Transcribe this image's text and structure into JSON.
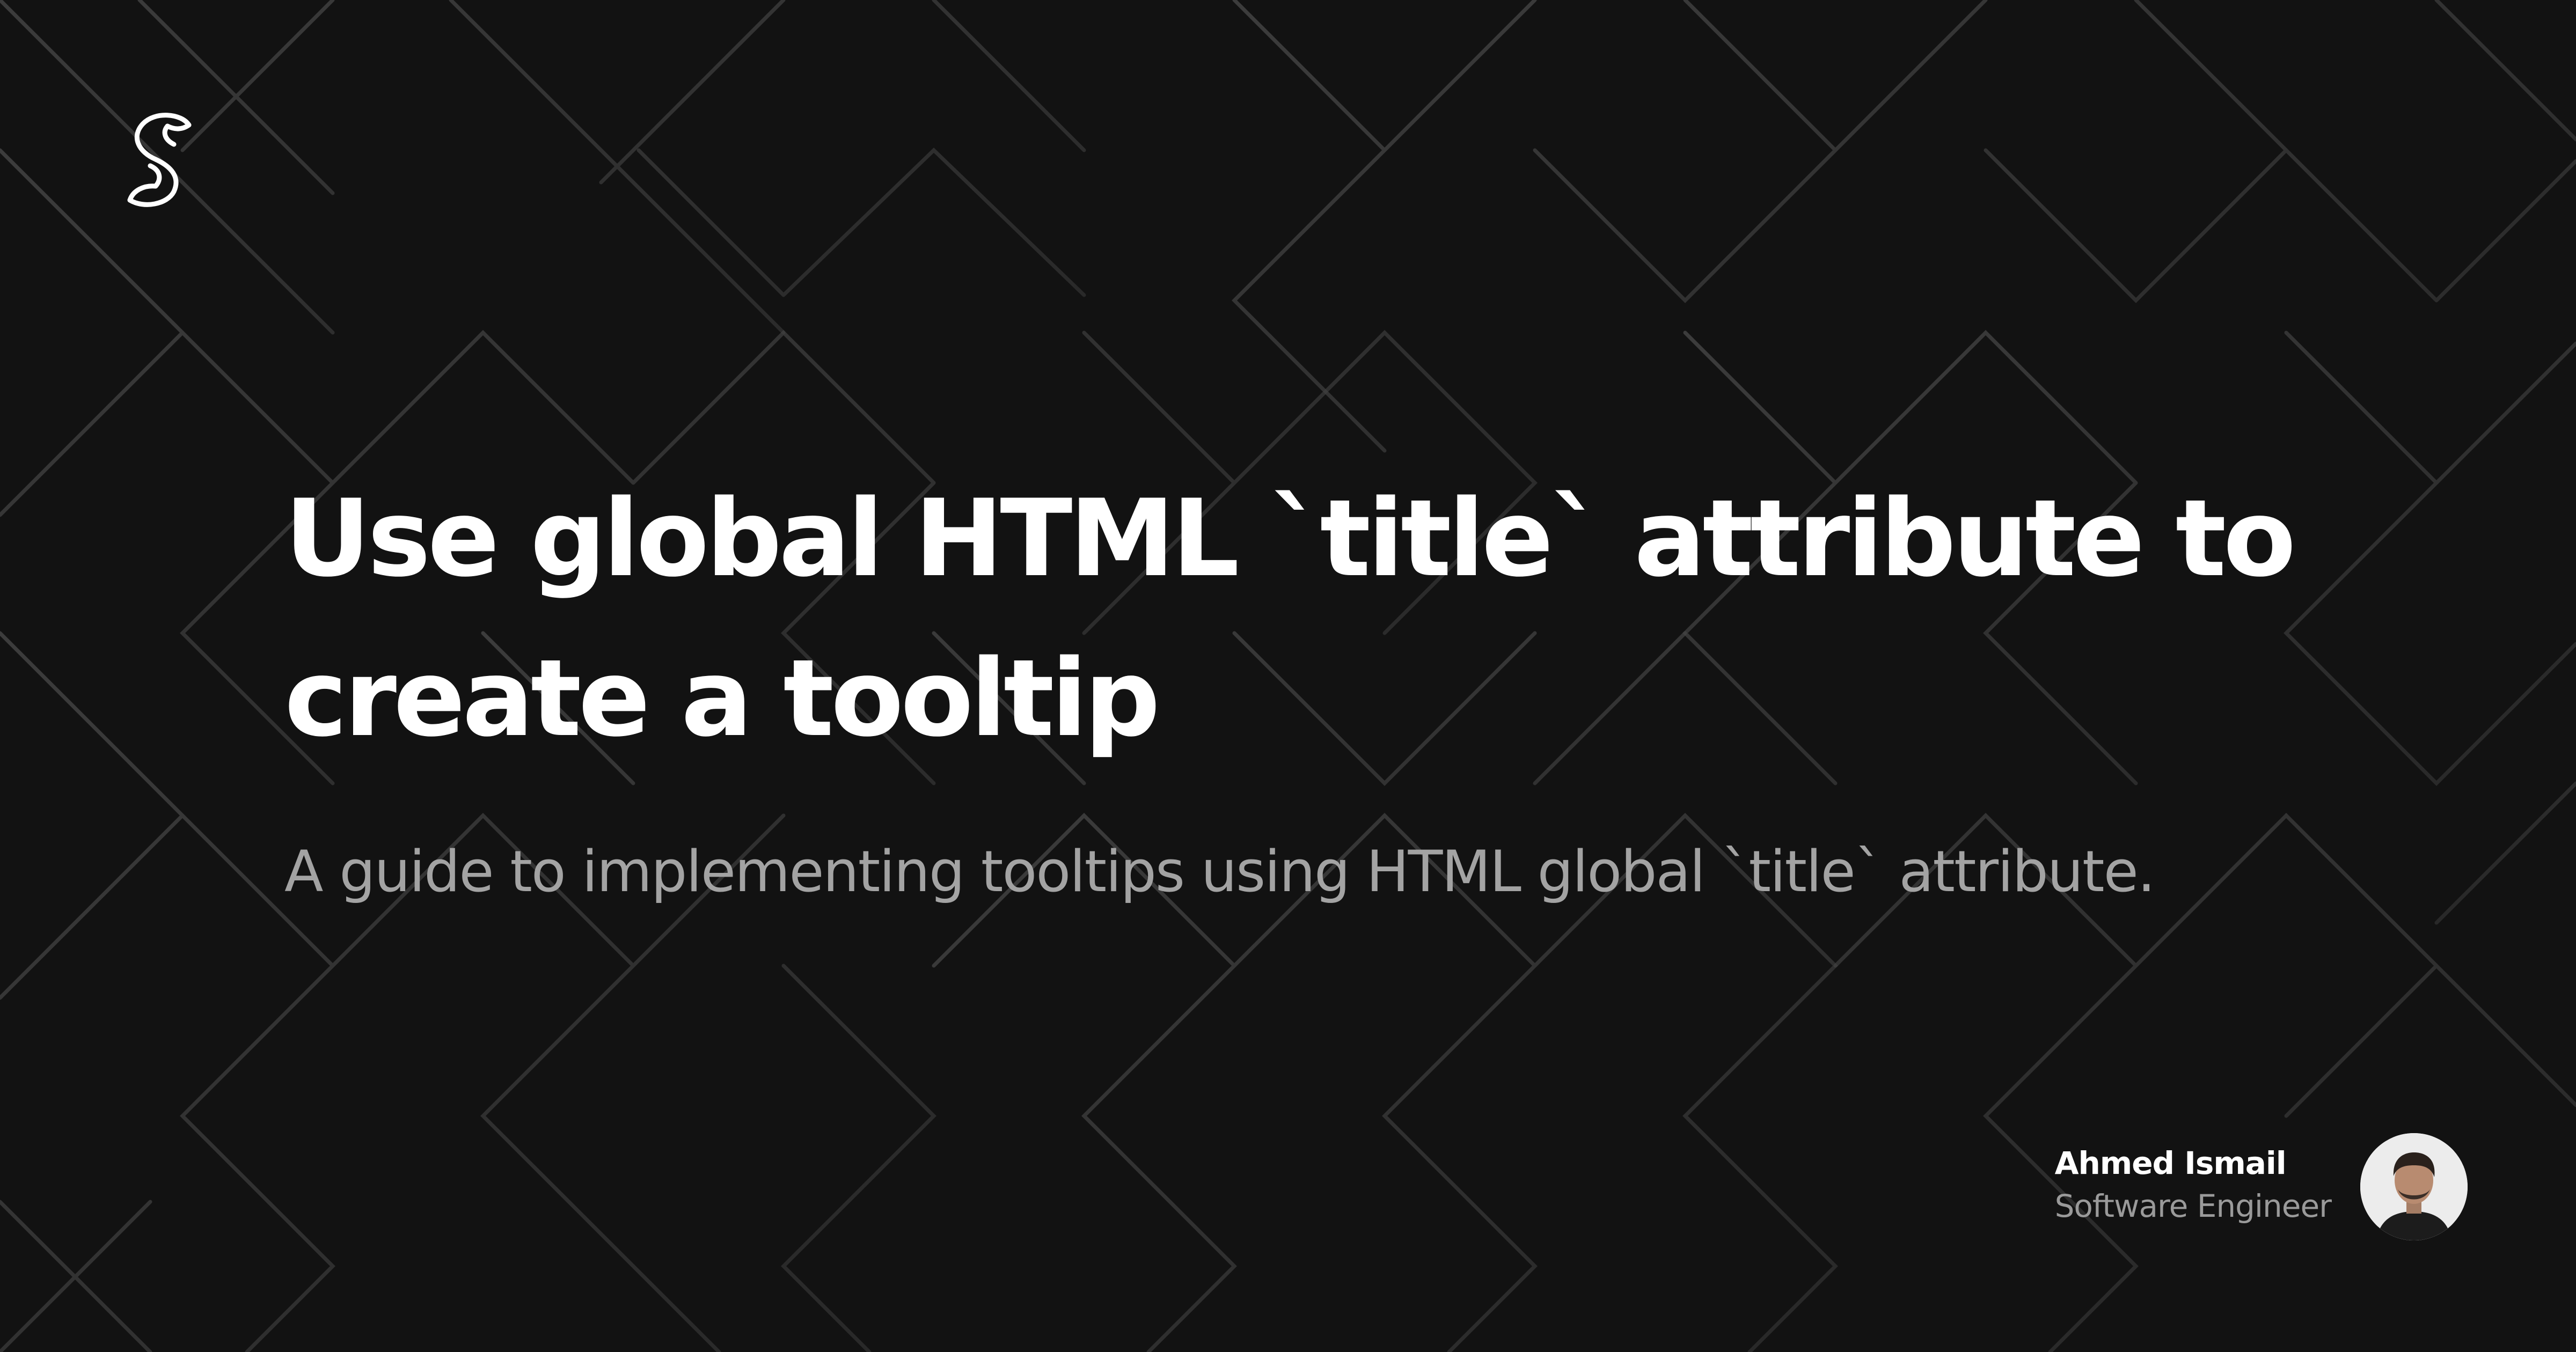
{
  "title": "Use global HTML `title` attribute to create a tooltip",
  "subtitle": "A guide to implementing tooltips using HTML global `title` attribute.",
  "author": {
    "name": "Ahmed Ismail",
    "role": "Software Engineer"
  },
  "icons": {
    "logo": "s-logo-icon",
    "avatar": "author-avatar"
  },
  "colors": {
    "background": "#121212",
    "title": "#ffffff",
    "subtitle": "#a3a3a3",
    "pattern_line": "#3a3a3a"
  }
}
